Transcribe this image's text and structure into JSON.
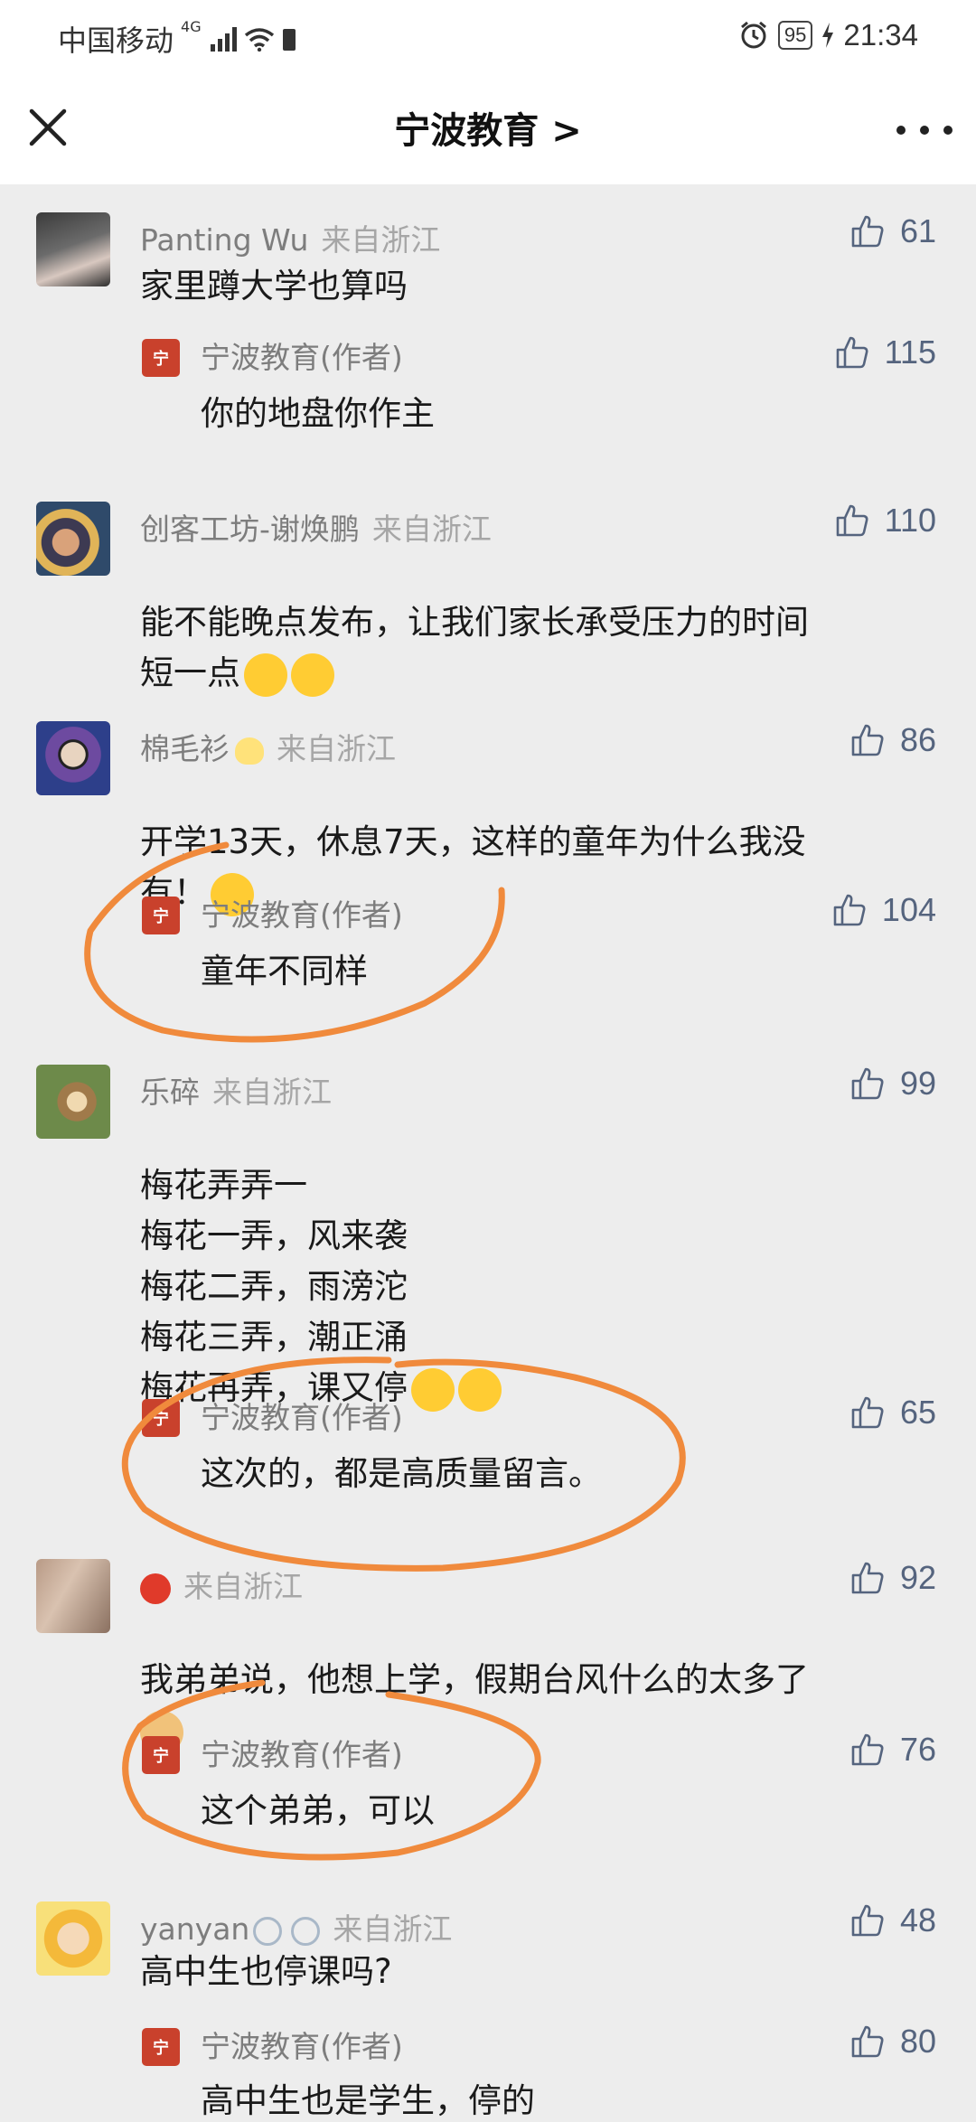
{
  "status_bar": {
    "carrier": "中国移动",
    "network": "4G",
    "battery": "95",
    "time": "21:34"
  },
  "header": {
    "title": "宁波教育 >"
  },
  "comments": [
    {
      "name": "Panting Wu",
      "location": "来自浙江",
      "likes": "61",
      "text": "家里蹲大学也算吗",
      "reply": {
        "name": "宁波教育(作者)",
        "text": "你的地盘你作主",
        "likes": "115"
      }
    },
    {
      "name": "创客工坊-谢焕鹏",
      "location": "来自浙江",
      "likes": "110",
      "text": "能不能晚点发布，让我们家长承受压力的时间\n短一点"
    },
    {
      "name": "棉毛衫",
      "location": "来自浙江",
      "likes": "86",
      "text": "开学13天，休息7天，这样的童年为什么我没\n有！",
      "reply": {
        "name": "宁波教育(作者)",
        "text": "童年不同样",
        "likes": "104"
      }
    },
    {
      "name": "乐碎",
      "location": "来自浙江",
      "likes": "99",
      "text": "梅花弄弄一\n梅花一弄，风来袭\n梅花二弄，雨滂沱\n梅花三弄，潮正涌\n梅花再弄，课又停",
      "reply": {
        "name": "宁波教育(作者)",
        "text": "这次的，都是高质量留言。",
        "likes": "65"
      }
    },
    {
      "name": "",
      "location": "来自浙江",
      "likes": "92",
      "text": "我弟弟说，他想上学，假期台风什么的太多了",
      "reply": {
        "name": "宁波教育(作者)",
        "text": "这个弟弟，可以",
        "likes": "76"
      }
    },
    {
      "name": "yanyan",
      "location": "来自浙江",
      "likes": "48",
      "text": "高中生也停课吗?",
      "reply": {
        "name": "宁波教育(作者)",
        "text": "高中生也是学生，停的",
        "likes": "80"
      }
    }
  ],
  "colors": {
    "annotation": "#f08a3c",
    "like": "#55647e",
    "author_badge": "#c9412c"
  }
}
